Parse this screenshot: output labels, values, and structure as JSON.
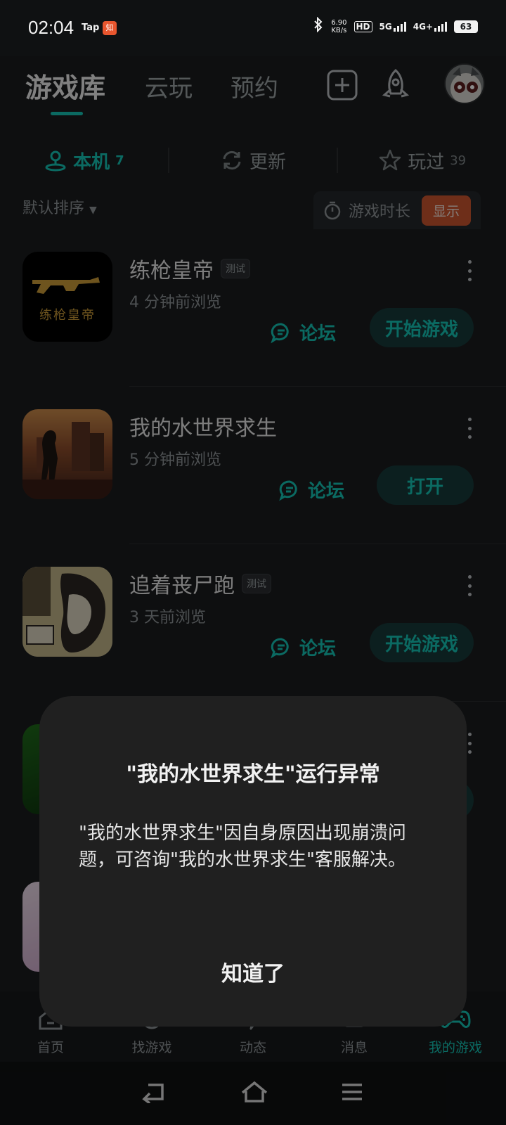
{
  "status_bar": {
    "time": "02:04",
    "tap_label": "Tap",
    "net_speed_value": "6.90",
    "net_speed_unit": "KB/s",
    "hd_label": "HD",
    "sim1_label": "5G",
    "sim2_label": "4G+",
    "battery": "63"
  },
  "header": {
    "tabs": [
      {
        "label": "游戏库",
        "active": true
      },
      {
        "label": "云玩",
        "active": false
      },
      {
        "label": "预约",
        "active": false
      }
    ]
  },
  "filters": [
    {
      "label": "本机",
      "count": "7",
      "active": true,
      "icon": "location-pin-icon"
    },
    {
      "label": "更新",
      "count": "",
      "active": false,
      "icon": "refresh-icon"
    },
    {
      "label": "玩过",
      "count": "39",
      "active": false,
      "icon": "star-icon"
    }
  ],
  "sort": {
    "label": "默认排序",
    "duration_label": "游戏时长",
    "show_button": "显示"
  },
  "games": [
    {
      "name": "练枪皇帝",
      "badge": "测试",
      "time": "4 分钟前浏览",
      "forum": "论坛",
      "action": "开始游戏",
      "thumb_text": "练枪皇帝"
    },
    {
      "name": "我的水世界求生",
      "badge": "",
      "time": "5 分钟前浏览",
      "forum": "论坛",
      "action": "打开"
    },
    {
      "name": "追着丧尸跑",
      "badge": "测试",
      "time": "3 天前浏览",
      "forum": "论坛",
      "action": "开始游戏"
    }
  ],
  "bottom_nav": [
    {
      "label": "首页",
      "icon": "home-icon",
      "active": false
    },
    {
      "label": "找游戏",
      "icon": "discover-icon",
      "active": false
    },
    {
      "label": "动态",
      "icon": "feed-icon",
      "active": false
    },
    {
      "label": "消息",
      "icon": "message-icon",
      "active": false
    },
    {
      "label": "我的游戏",
      "icon": "gamepad-icon",
      "active": true
    }
  ],
  "dialog": {
    "title": "\"我的水世界求生\"运行异常",
    "body": "\"我的水世界求生\"因自身原因出现崩溃问题，可咨询\"我的水世界求生\"客服解决。",
    "ok": "知道了"
  },
  "colors": {
    "accent": "#14c2b3",
    "background": "#1a1c1e",
    "dialog": "#202020",
    "show_button": "#c8552f"
  }
}
